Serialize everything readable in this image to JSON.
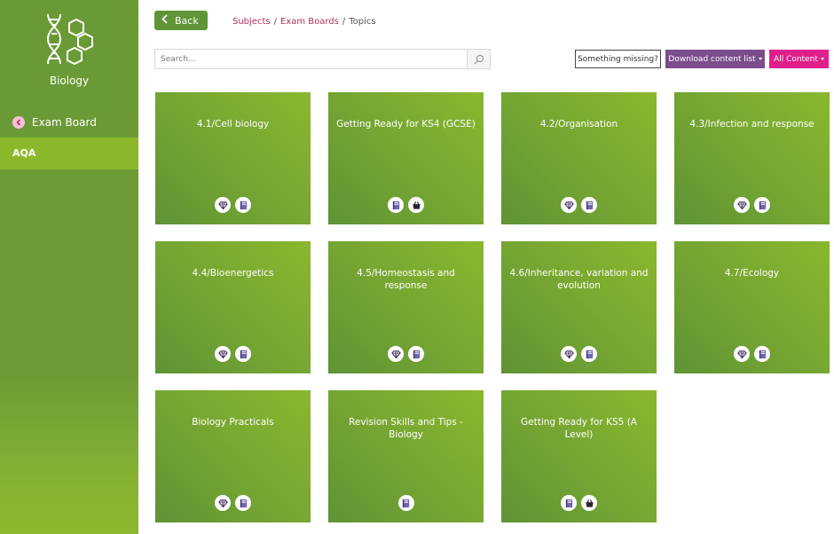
{
  "sidebar": {
    "subject": "Biology",
    "exam_board_label": "Exam Board",
    "active_item": "AQA"
  },
  "header": {
    "back_label": "Back",
    "breadcrumb": [
      "Subjects",
      "Exam Boards",
      "Topics"
    ]
  },
  "search": {
    "placeholder": "Search..."
  },
  "actions": {
    "missing_label": "Something missing?",
    "download_label": "Download content list",
    "all_content_label": "All Content"
  },
  "cards": [
    {
      "title": "4.1/Cell biology",
      "icons": [
        "diamond-icon",
        "book-icon"
      ]
    },
    {
      "title": "Getting Ready for KS4 (GCSE)",
      "icons": [
        "book-icon",
        "basket-icon"
      ]
    },
    {
      "title": "4.2/Organisation",
      "icons": [
        "diamond-icon",
        "book-icon"
      ]
    },
    {
      "title": "4.3/Infection and response",
      "icons": [
        "diamond-icon",
        "book-icon"
      ]
    },
    {
      "title": "4.4/Bioenergetics",
      "icons": [
        "diamond-icon",
        "book-icon"
      ]
    },
    {
      "title": "4.5/Homeostasis and response",
      "icons": [
        "diamond-icon",
        "book-icon"
      ]
    },
    {
      "title": "4.6/Inheritance, variation and evolution",
      "icons": [
        "diamond-icon",
        "book-icon"
      ]
    },
    {
      "title": "4.7/Ecology",
      "icons": [
        "diamond-icon",
        "book-icon"
      ]
    },
    {
      "title": "Biology Practicals",
      "icons": [
        "diamond-icon",
        "book-icon"
      ]
    },
    {
      "title": "Revision Skills and Tips - Biology",
      "icons": [
        "book-icon"
      ]
    },
    {
      "title": "Getting Ready for KS5 (A Level)",
      "icons": [
        "book-icon",
        "basket-icon"
      ]
    }
  ],
  "colors": {
    "sidebar": "#6c9b36",
    "active": "#8bb82b",
    "card_light": "#8ab72d",
    "card_dark": "#5f9336",
    "download": "#7b4d8c",
    "all_content": "#e01f8a",
    "link": "#b0305e"
  }
}
